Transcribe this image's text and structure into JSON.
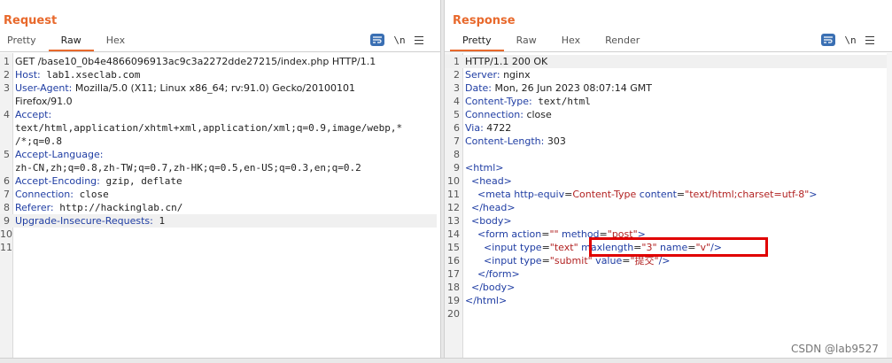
{
  "request": {
    "title": "Request",
    "tabs": [
      "Pretty",
      "Raw",
      "Hex"
    ],
    "active_tab": "Raw",
    "newline_label": "\\n",
    "lines": [
      {
        "n": "1",
        "segs": [
          {
            "t": "GET /base10_0b4e4866096913ac9c3a2272dde27215/index.php HTTP/1.1",
            "c": ""
          }
        ]
      },
      {
        "n": "2",
        "segs": [
          {
            "t": "Host:",
            "c": "hdr"
          },
          {
            "t": " lab1.xseclab.com",
            "c": "mono"
          }
        ]
      },
      {
        "n": "3",
        "segs": [
          {
            "t": "User-Agent:",
            "c": "hdr"
          },
          {
            "t": " Mozilla/5.0 (X11; Linux x86_64; rv:91.0) Gecko/20100101",
            "c": ""
          }
        ]
      },
      {
        "n": "",
        "segs": [
          {
            "t": "Firefox/91.0",
            "c": ""
          }
        ]
      },
      {
        "n": "4",
        "segs": [
          {
            "t": "Accept:",
            "c": "hdr"
          }
        ]
      },
      {
        "n": "",
        "segs": [
          {
            "t": "text/html,application/xhtml+xml,application/xml;q=0.9,image/webp,*",
            "c": "mono"
          }
        ]
      },
      {
        "n": "",
        "segs": [
          {
            "t": "/*;q=0.8",
            "c": "mono"
          }
        ]
      },
      {
        "n": "5",
        "segs": [
          {
            "t": "Accept-Language:",
            "c": "hdr"
          }
        ]
      },
      {
        "n": "",
        "segs": [
          {
            "t": "zh-CN,zh;q=0.8,zh-TW;q=0.7,zh-HK;q=0.5,en-US;q=0.3,en;q=0.2",
            "c": "mono"
          }
        ]
      },
      {
        "n": "6",
        "segs": [
          {
            "t": "Accept-Encoding:",
            "c": "hdr"
          },
          {
            "t": " gzip, deflate",
            "c": "mono"
          }
        ]
      },
      {
        "n": "7",
        "segs": [
          {
            "t": "Connection:",
            "c": "hdr"
          },
          {
            "t": " close",
            "c": "mono"
          }
        ]
      },
      {
        "n": "8",
        "segs": [
          {
            "t": "Referer:",
            "c": "hdr"
          },
          {
            "t": " http://hackinglab.cn/",
            "c": "mono"
          }
        ]
      },
      {
        "n": "9",
        "segs": [
          {
            "t": "Upgrade-Insecure-Requests:",
            "c": "hdr"
          },
          {
            "t": " 1",
            "c": "mono"
          }
        ],
        "hl": true
      },
      {
        "n": "10",
        "segs": []
      },
      {
        "n": "11",
        "segs": []
      }
    ]
  },
  "response": {
    "title": "Response",
    "tabs": [
      "Pretty",
      "Raw",
      "Hex",
      "Render"
    ],
    "active_tab": "Pretty",
    "newline_label": "\\n",
    "lines": [
      {
        "n": "1",
        "segs": [
          {
            "t": "HTTP/1.1 200 OK",
            "c": ""
          }
        ],
        "hl": true
      },
      {
        "n": "2",
        "segs": [
          {
            "t": "Server:",
            "c": "hdr"
          },
          {
            "t": " nginx",
            "c": ""
          }
        ]
      },
      {
        "n": "3",
        "segs": [
          {
            "t": "Date:",
            "c": "hdr"
          },
          {
            "t": " Mon, 26 Jun 2023 08:07:14 GMT",
            "c": ""
          }
        ]
      },
      {
        "n": "4",
        "segs": [
          {
            "t": "Content-Type:",
            "c": "hdr"
          },
          {
            "t": " text/html",
            "c": "mono"
          }
        ]
      },
      {
        "n": "5",
        "segs": [
          {
            "t": "Connection:",
            "c": "hdr"
          },
          {
            "t": " close",
            "c": ""
          }
        ]
      },
      {
        "n": "6",
        "segs": [
          {
            "t": "Via:",
            "c": "hdr"
          },
          {
            "t": " 4722",
            "c": ""
          }
        ]
      },
      {
        "n": "7",
        "segs": [
          {
            "t": "Content-Length:",
            "c": "hdr"
          },
          {
            "t": " 303",
            "c": ""
          }
        ]
      },
      {
        "n": "8",
        "segs": []
      },
      {
        "n": "9",
        "segs": [
          {
            "t": "<html>",
            "c": "tag"
          }
        ]
      },
      {
        "n": "10",
        "segs": [
          {
            "t": "  <head>",
            "c": "tag"
          }
        ]
      },
      {
        "n": "11",
        "segs": [
          {
            "t": "    <meta ",
            "c": "tag"
          },
          {
            "t": "http-equiv",
            "c": "attr"
          },
          {
            "t": "=",
            "c": ""
          },
          {
            "t": "Content-Type",
            "c": "val"
          },
          {
            "t": " content",
            "c": "attr"
          },
          {
            "t": "=",
            "c": ""
          },
          {
            "t": "\"text/html;charset=utf-8\"",
            "c": "val"
          },
          {
            "t": ">",
            "c": "tag"
          }
        ]
      },
      {
        "n": "12",
        "segs": [
          {
            "t": "  </head>",
            "c": "tag"
          }
        ]
      },
      {
        "n": "13",
        "segs": [
          {
            "t": "  <body>",
            "c": "tag"
          }
        ]
      },
      {
        "n": "14",
        "segs": [
          {
            "t": "    <form ",
            "c": "tag"
          },
          {
            "t": "action",
            "c": "attr"
          },
          {
            "t": "=",
            "c": ""
          },
          {
            "t": "\"\"",
            "c": "val"
          },
          {
            "t": " method",
            "c": "attr"
          },
          {
            "t": "=",
            "c": ""
          },
          {
            "t": "\"post\"",
            "c": "val"
          },
          {
            "t": ">",
            "c": "tag"
          }
        ]
      },
      {
        "n": "15",
        "segs": [
          {
            "t": "      <input ",
            "c": "tag"
          },
          {
            "t": "type",
            "c": "attr"
          },
          {
            "t": "=",
            "c": ""
          },
          {
            "t": "\"text\"",
            "c": "val"
          },
          {
            "t": " maxlength",
            "c": "attr"
          },
          {
            "t": "=",
            "c": ""
          },
          {
            "t": "\"3\"",
            "c": "val"
          },
          {
            "t": " name",
            "c": "attr"
          },
          {
            "t": "=",
            "c": ""
          },
          {
            "t": "\"v\"",
            "c": "val"
          },
          {
            "t": "/>",
            "c": "tag"
          }
        ]
      },
      {
        "n": "16",
        "segs": [
          {
            "t": "      <input ",
            "c": "tag"
          },
          {
            "t": "type",
            "c": "attr"
          },
          {
            "t": "=",
            "c": ""
          },
          {
            "t": "\"submit\"",
            "c": "val"
          },
          {
            "t": " value",
            "c": "attr"
          },
          {
            "t": "=",
            "c": ""
          },
          {
            "t": "\"提交\"",
            "c": "val"
          },
          {
            "t": "/>",
            "c": "tag"
          }
        ]
      },
      {
        "n": "17",
        "segs": [
          {
            "t": "    </form>",
            "c": "tag"
          }
        ]
      },
      {
        "n": "18",
        "segs": [
          {
            "t": "  </body>",
            "c": "tag"
          }
        ]
      },
      {
        "n": "19",
        "segs": [
          {
            "t": "</html>",
            "c": "tag"
          }
        ]
      },
      {
        "n": "20",
        "segs": []
      }
    ]
  },
  "watermark": "CSDN @lab9527",
  "colors": {
    "accent": "#e8692c",
    "header_key": "#1f3da3",
    "string_value": "#b22222",
    "annotation_box": "#e00000"
  }
}
